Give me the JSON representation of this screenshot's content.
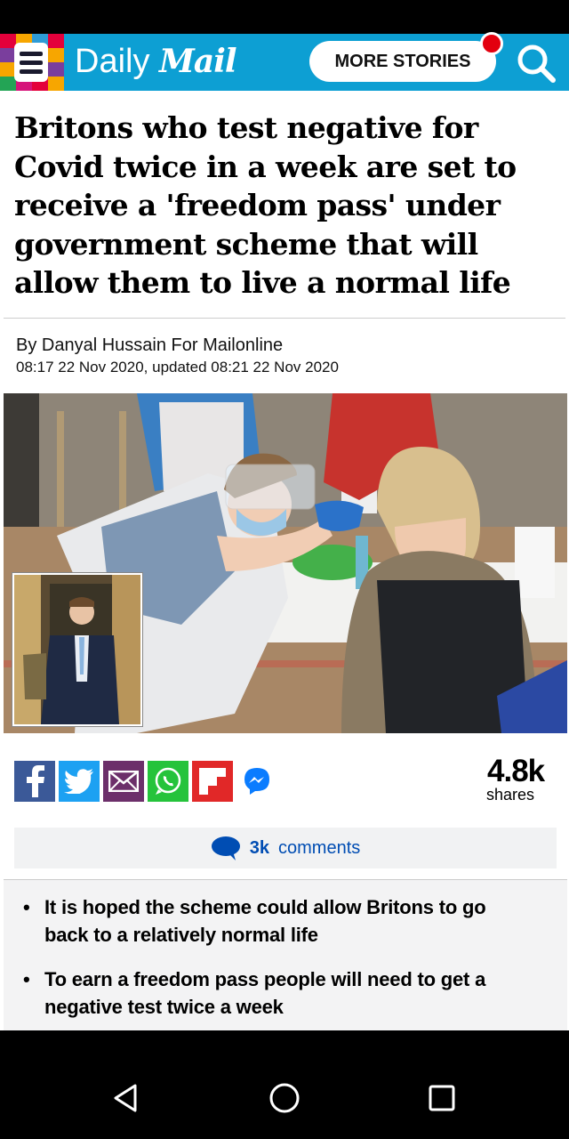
{
  "header": {
    "logo_part1": "Daily",
    "logo_part2": "Mail",
    "more_stories_label": "MORE STORIES",
    "brand_color": "#0d9fd3",
    "menu_icon": "menu-icon",
    "search_icon": "search-icon"
  },
  "article": {
    "headline": "Britons who test negative for Covid twice in a week are set to receive a 'freedom pass' under government scheme that will allow them to live a normal life",
    "byline": "By Danyal Hussain For Mailonline",
    "dateline": "08:17 22 Nov 2020, updated 08:21 22 Nov 2020"
  },
  "share": {
    "icons": [
      "facebook-icon",
      "twitter-icon",
      "email-icon",
      "whatsapp-icon",
      "flipboard-icon",
      "messenger-icon"
    ],
    "count": "4.8k",
    "label": "shares"
  },
  "comments": {
    "count": "3k",
    "label": "comments"
  },
  "summary": {
    "bullets": [
      "It is hoped the scheme could allow Britons to go back to a relatively normal life",
      "To earn a freedom pass people will need to get a negative test twice a week"
    ]
  },
  "nav": {
    "icons": [
      "back-icon",
      "home-icon",
      "recents-icon"
    ]
  }
}
